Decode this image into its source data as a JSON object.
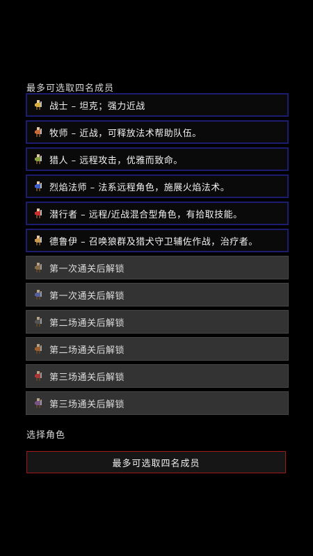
{
  "header": {
    "title": "最多可选取四名成员"
  },
  "roles": [
    {
      "label": "战士 – 坦克；强力近战",
      "icon": "warrior-icon",
      "color": "#d8b040",
      "locked": false
    },
    {
      "label": "牧师 – 近战，可释放法术帮助队伍。",
      "icon": "priest-icon",
      "color": "#c86a3a",
      "locked": false
    },
    {
      "label": "猎人 – 远程攻击，优雅而致命。",
      "icon": "hunter-icon",
      "color": "#8aa040",
      "locked": false
    },
    {
      "label": "烈焰法师 – 法系远程角色，施展火焰法术。",
      "icon": "fire-mage-icon",
      "color": "#4060c8",
      "locked": false
    },
    {
      "label": "潜行者 – 远程/近战混合型角色，有拾取技能。",
      "icon": "rogue-icon",
      "color": "#c83030",
      "locked": false
    },
    {
      "label": "德鲁伊 – 召唤狼群及猎犬守卫辅佐作战，治疗者。",
      "icon": "druid-icon",
      "color": "#c89a50",
      "locked": false
    },
    {
      "label": "第一次通关后解锁",
      "icon": "locked-hero-1-icon",
      "color": "#a08050",
      "locked": true
    },
    {
      "label": "第一次通关后解锁",
      "icon": "locked-hero-2-icon",
      "color": "#6070c0",
      "locked": true
    },
    {
      "label": "第二场通关后解锁",
      "icon": "locked-hero-3-icon",
      "color": "#606060",
      "locked": true
    },
    {
      "label": "第二场通关后解锁",
      "icon": "locked-hero-4-icon",
      "color": "#c07030",
      "locked": true
    },
    {
      "label": "第三场通关后解锁",
      "icon": "locked-hero-5-icon",
      "color": "#d03a3a",
      "locked": true
    },
    {
      "label": "第三场通关后解锁",
      "icon": "locked-hero-6-icon",
      "color": "#9060a0",
      "locked": true
    }
  ],
  "footer": {
    "section_label": "选择角色",
    "confirm_label": "最多可选取四名成员"
  },
  "colors": {
    "unlocked_border": "#1c1c70",
    "locked_bg": "#333333",
    "confirm_border": "#a01818"
  }
}
